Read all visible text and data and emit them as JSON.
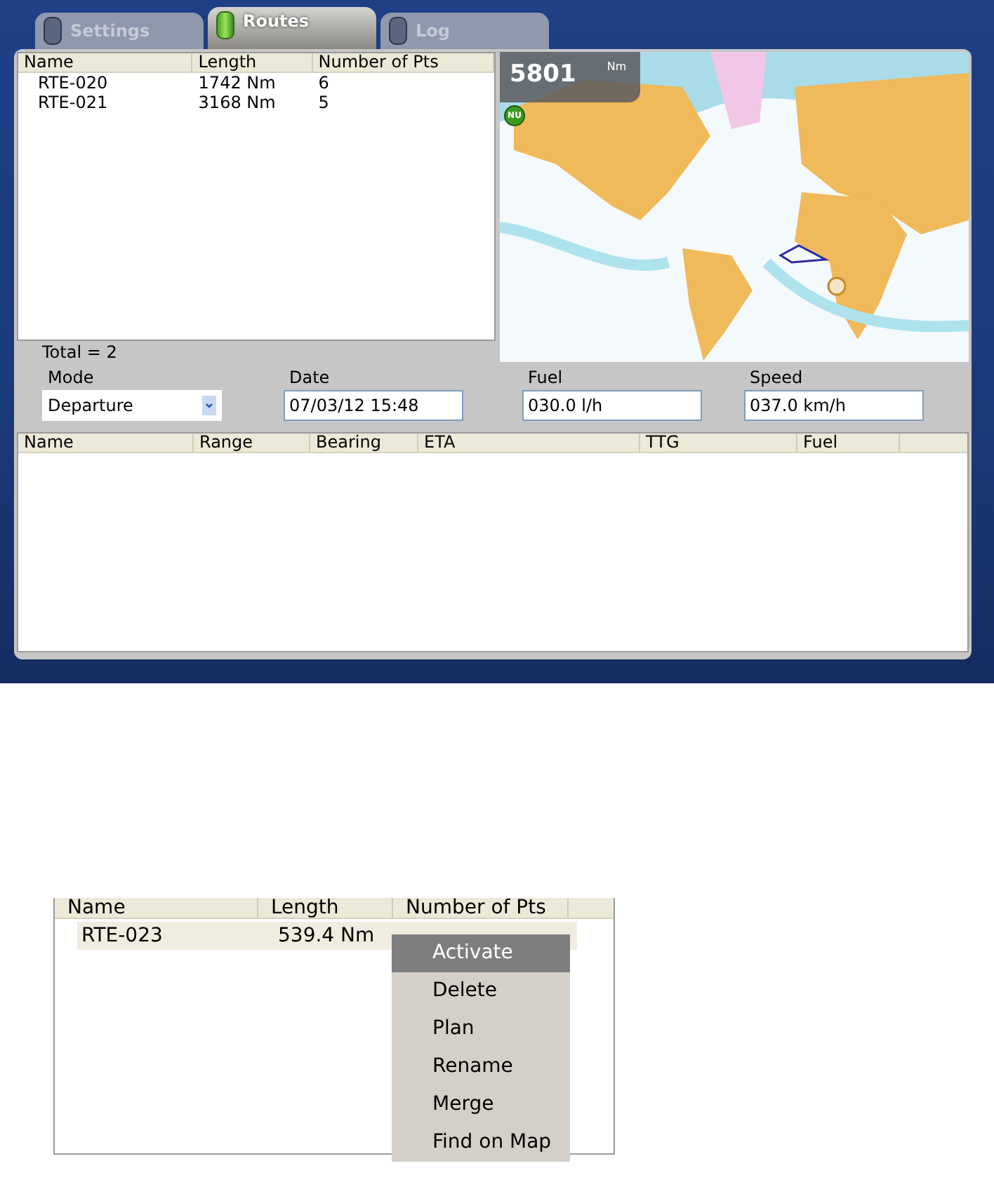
{
  "tabs": [
    {
      "label": "Settings",
      "selected": false
    },
    {
      "label": "Routes",
      "selected": true
    },
    {
      "label": "Log",
      "selected": false
    }
  ],
  "routes_table": {
    "columns": [
      "Name",
      "Length",
      "Number of Pts"
    ],
    "rows": [
      {
        "cells": [
          "RTE-020",
          "1742 Nm",
          "6"
        ]
      },
      {
        "cells": [
          "RTE-021",
          "3168 Nm",
          "5"
        ]
      }
    ]
  },
  "total": "Total = 2",
  "map": {
    "kind": "picture",
    "distance": "5801",
    "unit": "Nm",
    "north_button": "NU"
  },
  "fields": [
    {
      "label": "Mode",
      "value": "Departure",
      "kind": "dropdown"
    },
    {
      "label": "Date",
      "value": "07/03/12 15:48",
      "kind": "text"
    },
    {
      "label": "Fuel",
      "value": "030.0 l/h",
      "kind": "text"
    },
    {
      "label": "Speed",
      "value": "037.0 km/h",
      "kind": "text"
    }
  ],
  "legs_table": {
    "columns": [
      "Name",
      "Range",
      "Bearing",
      "ETA",
      "TTG",
      "Fuel"
    ]
  },
  "context_example": {
    "columns": [
      "Name",
      "Length",
      "Number of Pts"
    ],
    "rows": [
      {
        "cells": [
          "RTE-023",
          "539.4 Nm"
        ],
        "selected": true
      }
    ],
    "menu": [
      {
        "label": "Activate",
        "selected": true
      },
      {
        "label": "Delete",
        "selected": false
      },
      {
        "label": "Plan",
        "selected": false
      },
      {
        "label": "Rename",
        "selected": false
      },
      {
        "label": "Merge",
        "selected": false
      },
      {
        "label": "Find on Map",
        "selected": false
      }
    ]
  }
}
